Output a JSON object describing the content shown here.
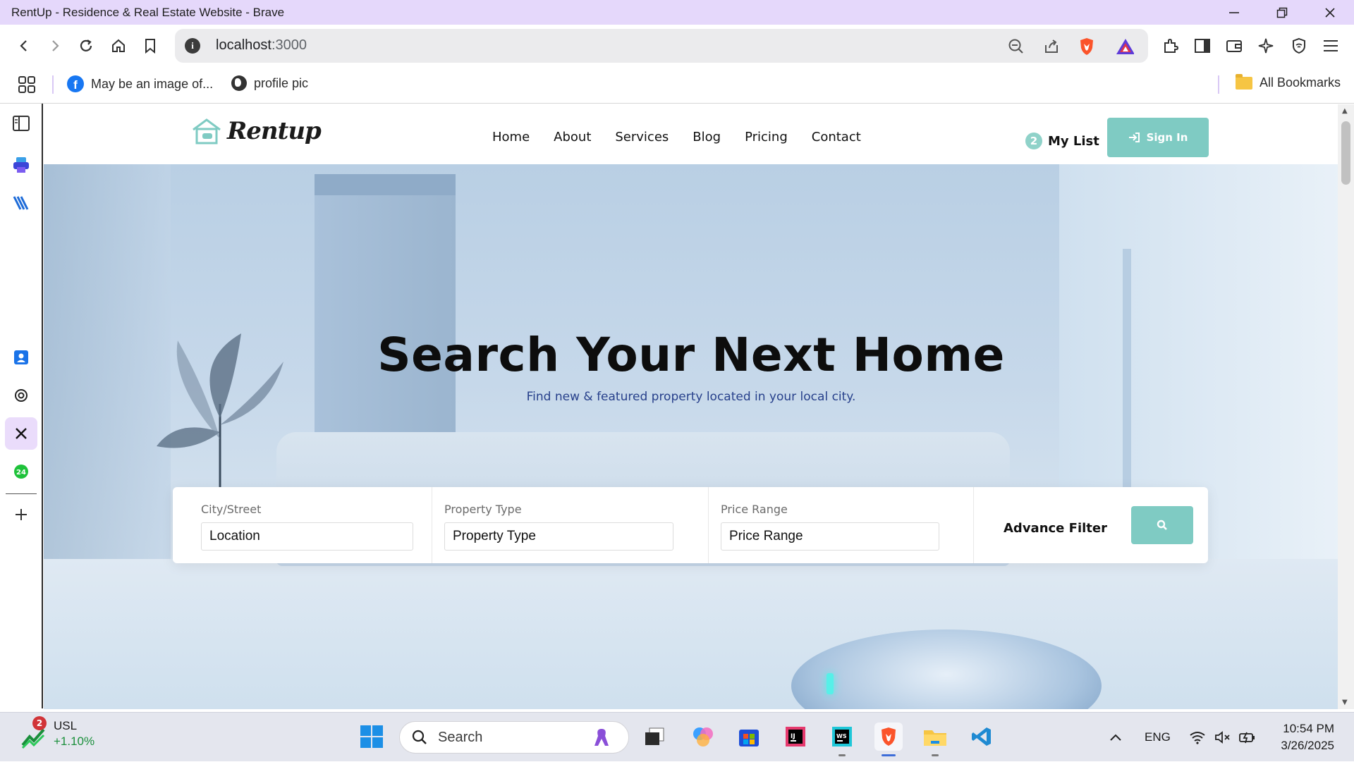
{
  "window": {
    "title": "RentUp - Residence & Real Estate Website - Brave"
  },
  "toolbar": {
    "url_host": "localhost",
    "url_port": ":3000"
  },
  "bookmarks": {
    "items": [
      {
        "label": "May be an image of..."
      },
      {
        "label": "profile pic"
      }
    ],
    "all_label": "All Bookmarks"
  },
  "site": {
    "logo_text": "Rentup",
    "nav": [
      "Home",
      "About",
      "Services",
      "Blog",
      "Pricing",
      "Contact"
    ],
    "mylist": {
      "count": "2",
      "label": "My List"
    },
    "signin_label": "Sign In",
    "hero": {
      "title": "Search Your Next Home",
      "subtitle": "Find new & featured property located in your local city."
    },
    "search": {
      "city_label": "City/Street",
      "city_placeholder": "Location",
      "type_label": "Property Type",
      "type_placeholder": "Property Type",
      "price_label": "Price Range",
      "price_placeholder": "Price Range",
      "advance_label": "Advance Filter"
    },
    "accent": "#7fcbc3"
  },
  "taskbar": {
    "weather": {
      "badge": "2",
      "title": "USL",
      "change": "+1.10%"
    },
    "search_label": "Search",
    "language": "ENG",
    "time": "10:54 PM",
    "date": "3/26/2025"
  }
}
